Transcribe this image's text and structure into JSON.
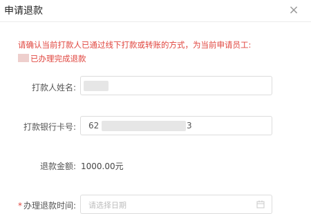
{
  "dialog": {
    "title": "申请退款",
    "close_glyph": "×"
  },
  "notice": {
    "line1": "请确认当前打款人已通过线下打款或转账的方式，为当前申请员工:",
    "line2": "已办理完成退款"
  },
  "form": {
    "payer_name_label": "打款人姓名:",
    "payer_card_label": "打款银行卡号:",
    "payer_card_prefix": "62",
    "payer_card_suffix": "3",
    "refund_amount_label": "退款金额:",
    "refund_amount_value": "1000.00元",
    "refund_time_required": "*",
    "refund_time_label": "办理退款时间:",
    "refund_time_placeholder": "请选择日期"
  },
  "colors": {
    "notice_red": "#e0463f",
    "required_red": "#e0463f",
    "border_gray": "#dcdcdc"
  },
  "icons": {
    "close": "close-icon",
    "calendar": "calendar-icon"
  }
}
